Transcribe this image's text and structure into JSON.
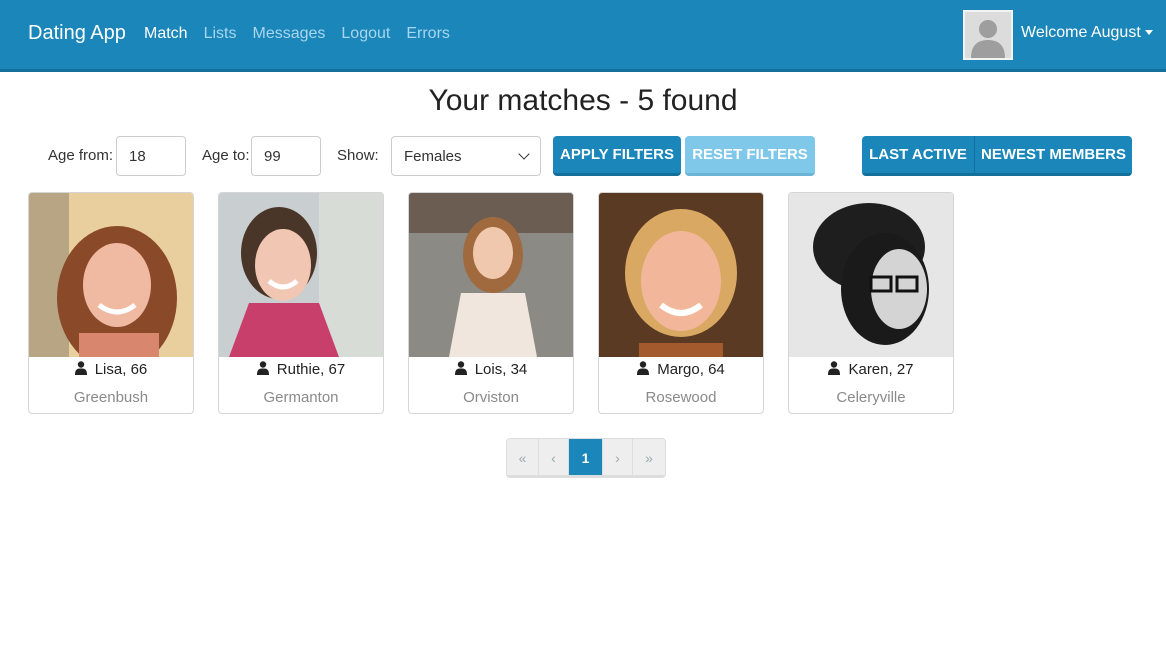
{
  "navbar": {
    "brand": "Dating App",
    "links": [
      {
        "label": "Match",
        "active": true
      },
      {
        "label": "Lists"
      },
      {
        "label": "Messages"
      },
      {
        "label": "Logout"
      },
      {
        "label": "Errors"
      }
    ],
    "welcome": "Welcome August",
    "avatar_icon": "user-silhouette-icon",
    "bg_color": "#1a86b9"
  },
  "title": "Your matches - 5 found",
  "filters": {
    "age_from_label": "Age from:",
    "age_from_value": "18",
    "age_to_label": "Age to:",
    "age_to_value": "99",
    "show_label": "Show:",
    "show_value": "Females",
    "apply_label": "APPLY FILTERS",
    "reset_label": "RESET FILTERS",
    "sort_last_active": "LAST ACTIVE",
    "sort_newest": "NEWEST MEMBERS"
  },
  "members": [
    {
      "name": "Lisa, 66",
      "city": "Greenbush"
    },
    {
      "name": "Ruthie, 67",
      "city": "Germanton"
    },
    {
      "name": "Lois, 34",
      "city": "Orviston"
    },
    {
      "name": "Margo, 64",
      "city": "Rosewood"
    },
    {
      "name": "Karen, 27",
      "city": "Celeryville"
    }
  ],
  "pagination": {
    "first": "«",
    "prev": "‹",
    "current": "1",
    "next": "›",
    "last": "»"
  }
}
